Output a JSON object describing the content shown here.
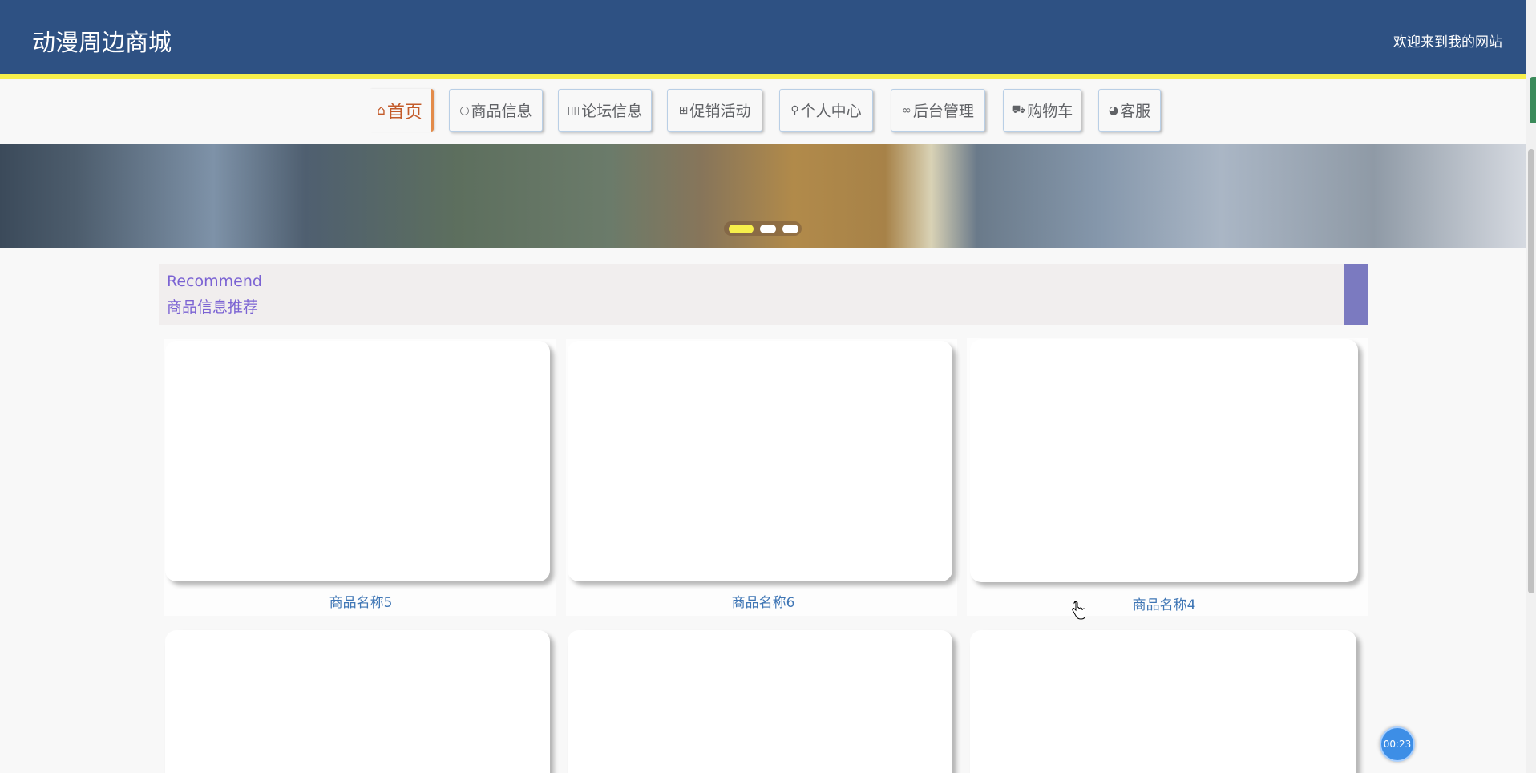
{
  "header": {
    "site_title": "动漫周边商城",
    "welcome": "欢迎来到我的网站"
  },
  "nav": {
    "items": [
      {
        "label": "首页",
        "icon": "home-icon",
        "glyph": "⌂"
      },
      {
        "label": "商品信息",
        "icon": "circle-icon",
        "glyph": "○"
      },
      {
        "label": "论坛信息",
        "icon": "chat-icon",
        "glyph": "▯▯"
      },
      {
        "label": "促销活动",
        "icon": "activity-icon",
        "glyph": "⊞"
      },
      {
        "label": "个人中心",
        "icon": "user-icon",
        "glyph": "⚲"
      },
      {
        "label": "后台管理",
        "icon": "link-icon",
        "glyph": "∞"
      },
      {
        "label": "购物车",
        "icon": "cart-icon",
        "glyph": "⛟"
      },
      {
        "label": "客服",
        "icon": "service-icon",
        "glyph": "◕"
      }
    ]
  },
  "banner": {
    "slides_count": 3,
    "active_slide": 1
  },
  "section": {
    "title_en": "Recommend",
    "title_cn": "商品信息推荐"
  },
  "products": [
    {
      "name": "商品名称5"
    },
    {
      "name": "商品名称6"
    },
    {
      "name": "商品名称4"
    },
    {
      "name": ""
    },
    {
      "name": ""
    },
    {
      "name": ""
    }
  ],
  "timer": {
    "value": "00:23"
  },
  "colors": {
    "header_bg": "#2e5183",
    "accent_yellow": "#f7f04b",
    "section_title": "#7b63d3",
    "product_name": "#3f76b5",
    "active_nav": "#c35b2a"
  }
}
